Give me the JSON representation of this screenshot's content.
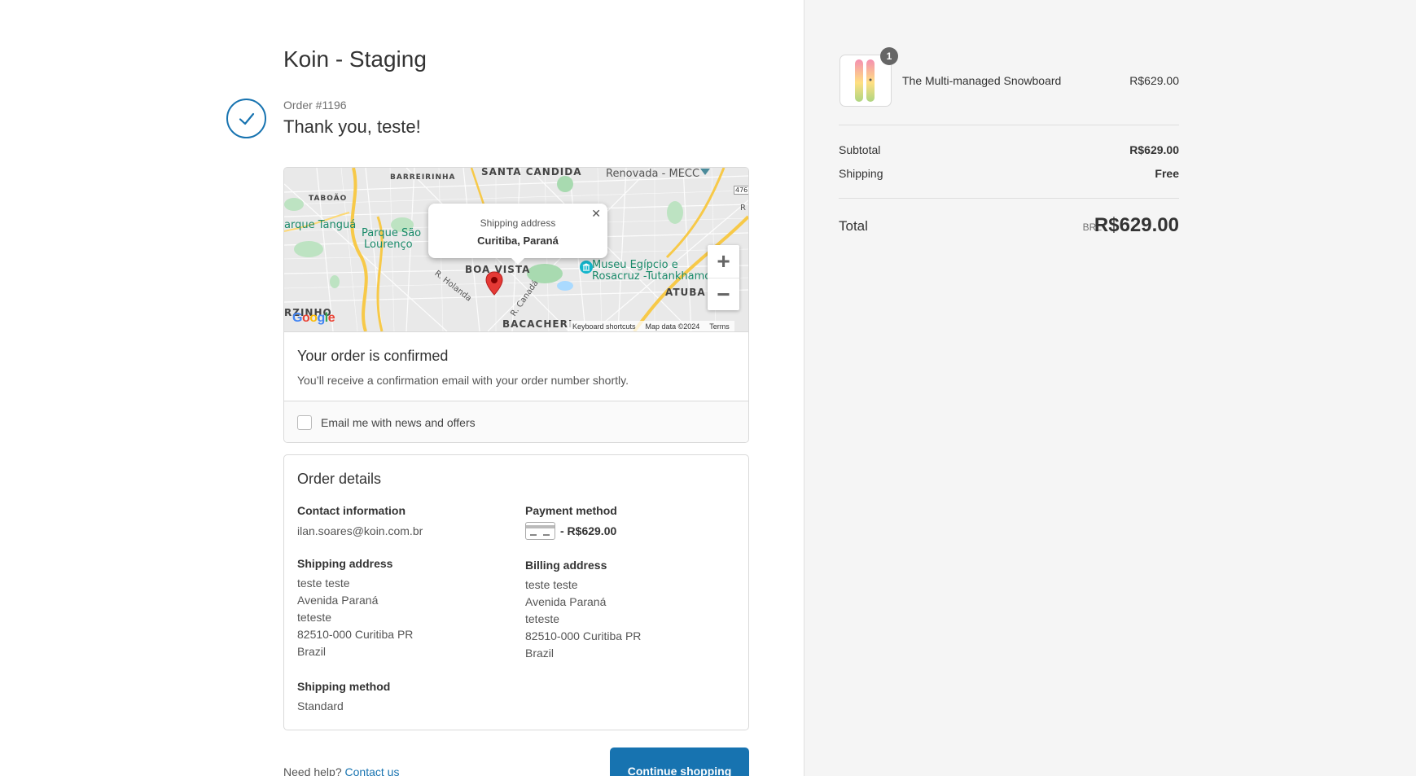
{
  "store": {
    "title": "Koin - Staging"
  },
  "order": {
    "number": "Order #1196",
    "thanks": "Thank you, teste!"
  },
  "map": {
    "popup_title": "Shipping address",
    "popup_city": "Curitiba, Paraná",
    "labels": {
      "santa_candida": "SANTA CANDIDA",
      "barreirinha": "BARREIRINHA",
      "taboao": "TABOÃO",
      "renovada": "Renovada - MECC",
      "parque_tangua": "arque Tanguá",
      "parque_sao_lourenco_1": "Parque São",
      "parque_sao_lourenco_2": "Lourenço",
      "boa_vista": "BOA VISTA",
      "museu_1": "Museu Egípcio e",
      "museu_2": "Rosacruz -Tutankhamon",
      "atuba": "ATUBA",
      "r_holanda": "R. Holanda",
      "r_canada": "R. Canadá",
      "rzinho": "RZINHO",
      "bacacheri": "BACACHERI",
      "road_476": "476",
      "r_edge": "R"
    },
    "google": "Google",
    "attribution": {
      "shortcuts": "Keyboard shortcuts",
      "data": "Map data ©2024",
      "terms": "Terms"
    },
    "zoom_in": "+",
    "zoom_out": "−",
    "close": "✕"
  },
  "confirmed": {
    "title": "Your order is confirmed",
    "text": "You’ll receive a confirmation email with your order number shortly."
  },
  "newsletter": {
    "label": "Email me with news and offers",
    "checked": false
  },
  "details": {
    "title": "Order details",
    "contact": {
      "heading": "Contact information",
      "email": "ilan.soares@koin.com.br"
    },
    "payment": {
      "heading": "Payment method",
      "amount": "- R$629.00"
    },
    "shipping_address": {
      "heading": "Shipping address",
      "lines": [
        "teste teste",
        "Avenida Paraná",
        "teteste",
        "82510-000 Curitiba PR",
        "Brazil"
      ]
    },
    "billing_address": {
      "heading": "Billing address",
      "lines": [
        "teste teste",
        "Avenida Paraná",
        "teteste",
        "82510-000 Curitiba PR",
        "Brazil"
      ]
    },
    "shipping_method": {
      "heading": "Shipping method",
      "value": "Standard"
    }
  },
  "footer": {
    "help": "Need help?",
    "contact_link": "Contact us",
    "continue": "Continue shopping"
  },
  "summary": {
    "item": {
      "name": "The Multi-managed Snowboard",
      "price": "R$629.00",
      "quantity": "1"
    },
    "subtotal_label": "Subtotal",
    "subtotal": "R$629.00",
    "shipping_label": "Shipping",
    "shipping": "Free",
    "total_label": "Total",
    "currency": "BRL",
    "total": "R$629.00"
  },
  "colors": {
    "accent": "#1773b0",
    "sidebar_bg": "#f5f5f5",
    "marker": "#e53935"
  }
}
